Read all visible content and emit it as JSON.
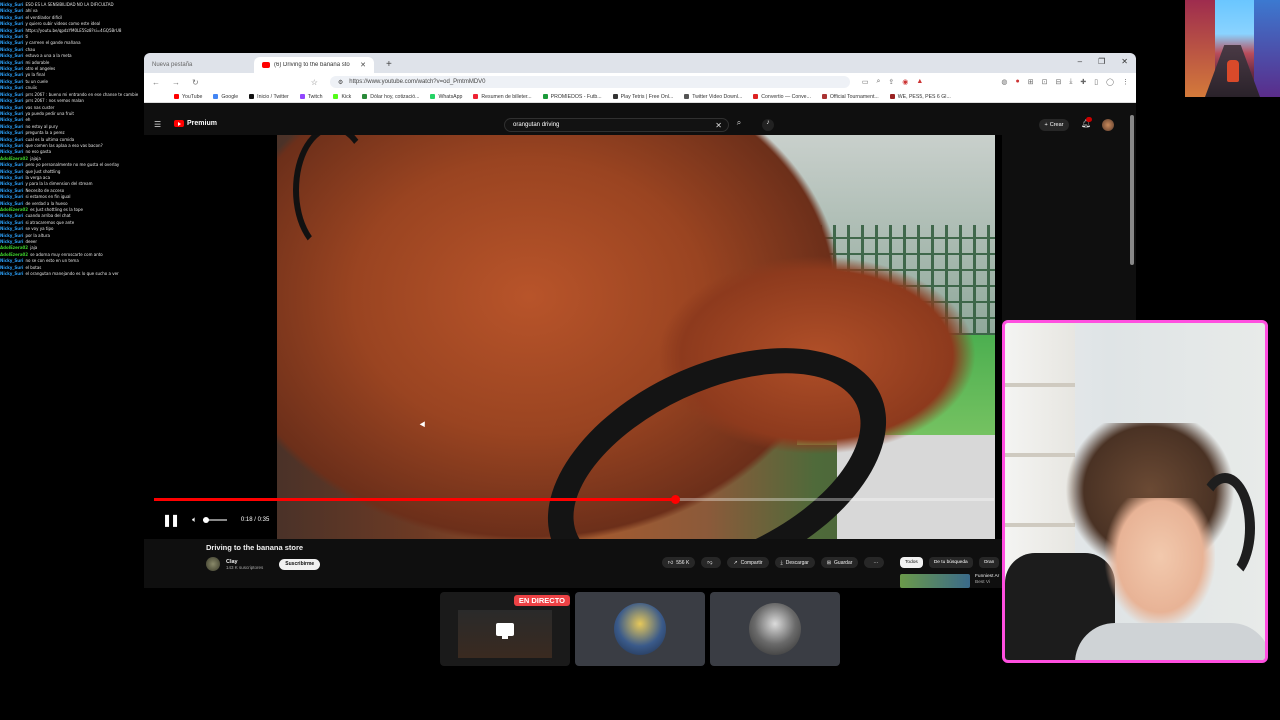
{
  "chat": [
    {
      "user": "Nicky_Suri",
      "msg": "ESO ES LA SENSIBILIDAD NO LA DIFICULTAD",
      "color": "blue"
    },
    {
      "user": "Nicky_Suri",
      "msg": "ahí va",
      "color": "blue"
    },
    {
      "user": "Nicky_Suri",
      "msg": "el ventilador difícil",
      "color": "blue"
    },
    {
      "user": "Nicky_Suri",
      "msg": "y quiero subir videos como este ideal",
      "color": "blue"
    },
    {
      "user": "Nicky_Suri",
      "msg": "https://youtu.be/qpdzYM0LE5Sz8?si=4GQ5BrU8",
      "color": "blue"
    },
    {
      "user": "Nicky_Suri",
      "msg": "ti",
      "color": "blue"
    },
    {
      "user": "Nicky_Suri",
      "msg": "y carreen el gande mañana",
      "color": "blue"
    },
    {
      "user": "Nicky_Suri",
      "msg": "chau",
      "color": "blue"
    },
    {
      "user": "Nicky_Suri",
      "msg": "estuvo a una a la meta",
      "color": "blue"
    },
    {
      "user": "Nicky_Suri",
      "msg": "mi adorable",
      "color": "blue"
    },
    {
      "user": "Nicky_Suri",
      "msg": "otro el angeles",
      "color": "blue"
    },
    {
      "user": "Nicky_Suri",
      "msg": "yo la final",
      "color": "blue"
    },
    {
      "user": "Nicky_Suri",
      "msg": "tu un cuele",
      "color": "blue"
    },
    {
      "user": "Nicky_Suri",
      "msg": "cnuiis",
      "color": "blue"
    },
    {
      "user": "Nicky_Suri",
      "msg": "prrs 2067 : bueno mi entrando en ese chanse te cambie",
      "color": "blue"
    },
    {
      "user": "Nicky_Suri",
      "msg": "prrs 2067 : nos vemos malan",
      "color": "blue"
    },
    {
      "user": "Nicky_Suri",
      "msg": "vas nas custer",
      "color": "blue"
    },
    {
      "user": "Nicky_Suri",
      "msg": "ya puedo pedir una fruit",
      "color": "blue"
    },
    {
      "user": "Nicky_Suri",
      "msg": "eh",
      "color": "blue"
    },
    {
      "user": "Nicky_Suri",
      "msg": "no estoy al pury",
      "color": "blue"
    },
    {
      "user": "Nicky_Suri",
      "msg": "pregunta la a perez",
      "color": "blue"
    },
    {
      "user": "Nicky_Suri",
      "msg": "cual es la ultima comida",
      "color": "blue"
    },
    {
      "user": "Nicky_Suri",
      "msg": "que comen las aplaa a eso vas bacon?",
      "color": "blue"
    },
    {
      "user": "Nicky_Suri",
      "msg": "no eso gasta",
      "color": "blue"
    },
    {
      "user": "AdolEzera02",
      "msg": "jajaja",
      "color": "green"
    },
    {
      "user": "Nicky_Suri",
      "msg": "pero yo personalmente no me gusta el overlay",
      "color": "blue"
    },
    {
      "user": "Nicky_Suri",
      "msg": "que Just shottling",
      "color": "blue"
    },
    {
      "user": "Nicky_Suri",
      "msg": "la verga aca",
      "color": "blue"
    },
    {
      "user": "Nicky_Suri",
      "msg": "y para la la dimension del stream",
      "color": "blue"
    },
    {
      "user": "Nicky_Suri",
      "msg": "Necesito de acceso",
      "color": "blue"
    },
    {
      "user": "Nicky_Suri",
      "msg": "si estamos en fin igual",
      "color": "blue"
    },
    {
      "user": "Nicky_Suri",
      "msg": "de verdad a la hueso",
      "color": "blue"
    },
    {
      "user": "AdolEzera02",
      "msg": "es Just shottling es la tope",
      "color": "green"
    },
    {
      "user": "Nicky_Suri",
      "msg": "cuando arriba del chat",
      "color": "blue"
    },
    {
      "user": "Nicky_Suri",
      "msg": "si atracaremos que ante",
      "color": "blue"
    },
    {
      "user": "Nicky_Suri",
      "msg": "se voy ya tipo",
      "color": "blue"
    },
    {
      "user": "Nicky_Suri",
      "msg": "por la altura",
      "color": "blue"
    },
    {
      "user": "Nicky_Suri",
      "msg": "deeer",
      "color": "blue"
    },
    {
      "user": "AdolEzera02",
      "msg": "jaja",
      "color": "green"
    },
    {
      "user": "AdolEzera02",
      "msg": "se adorna muy enroscarte com anto",
      "color": "green"
    },
    {
      "user": "Nicky_Suri",
      "msg": "no se con esto en un tema",
      "color": "blue"
    },
    {
      "user": "Nicky_Suri",
      "msg": "el botas",
      "color": "blue"
    },
    {
      "user": "Nicky_Suri",
      "msg": "el orangutan manejando es lo que sucho a ver",
      "color": "blue"
    }
  ],
  "browser": {
    "tabs": [
      {
        "label": "Nueva pestaña",
        "active": false
      },
      {
        "label": "(6) Driving to the banana sto",
        "active": true
      }
    ],
    "new_tab": "+",
    "window_controls": [
      "–",
      "❐",
      "✕"
    ],
    "url": "https://www.youtube.com/watch?v=od_PmtmMDV0",
    "bookmarks": [
      {
        "label": "YouTube",
        "color": "#ff0000"
      },
      {
        "label": "Google",
        "color": "#4285f4"
      },
      {
        "label": "Inicio / Twitter",
        "color": "#111111"
      },
      {
        "label": "Twitch",
        "color": "#9146ff"
      },
      {
        "label": "Kick",
        "color": "#53fc18"
      },
      {
        "label": "Dólar hoy, cotizació...",
        "color": "#2a8a3a"
      },
      {
        "label": "WhatsApp",
        "color": "#25d366"
      },
      {
        "label": "Resumen de billeter...",
        "color": "#e23"
      },
      {
        "label": "PROMIEDOS - Futb...",
        "color": "#1a9a3a"
      },
      {
        "label": "Play Tetris | Free Onl...",
        "color": "#333"
      },
      {
        "label": "Twitter Video Downl...",
        "color": "#555"
      },
      {
        "label": "Convertio — Conve...",
        "color": "#d22"
      },
      {
        "label": "Official Tournament...",
        "color": "#a33"
      },
      {
        "label": "WE, PES5, PES 6 Gl...",
        "color": "#922"
      }
    ]
  },
  "youtube": {
    "logo": "Premium",
    "search_value": "orangutan driving",
    "create_label": "Crear",
    "video": {
      "title": "Driving to the banana store",
      "time": "0:18 / 0:35",
      "progress": 0.62
    },
    "channel": {
      "name": "Clay",
      "subs": "143 K suscriptores",
      "subscribe": "Suscribirme"
    },
    "actions": [
      {
        "label": "556 K",
        "icon": "like-icon"
      },
      {
        "label": "",
        "icon": "dislike-icon"
      },
      {
        "label": "Compartir",
        "icon": "share-icon"
      },
      {
        "label": "Descargar",
        "icon": "download-icon"
      },
      {
        "label": "Guardar",
        "icon": "save-icon"
      },
      {
        "label": "···",
        "icon": "more-icon"
      }
    ],
    "chips": [
      {
        "label": "Todos",
        "active": true
      },
      {
        "label": "De tu búsqueda",
        "active": false
      },
      {
        "label": "Oran",
        "active": false
      }
    ],
    "recommendation": {
      "title": "Funniest Ar",
      "sub": "Best Vi"
    }
  },
  "call": {
    "live_label": "EN DIRECTO"
  }
}
